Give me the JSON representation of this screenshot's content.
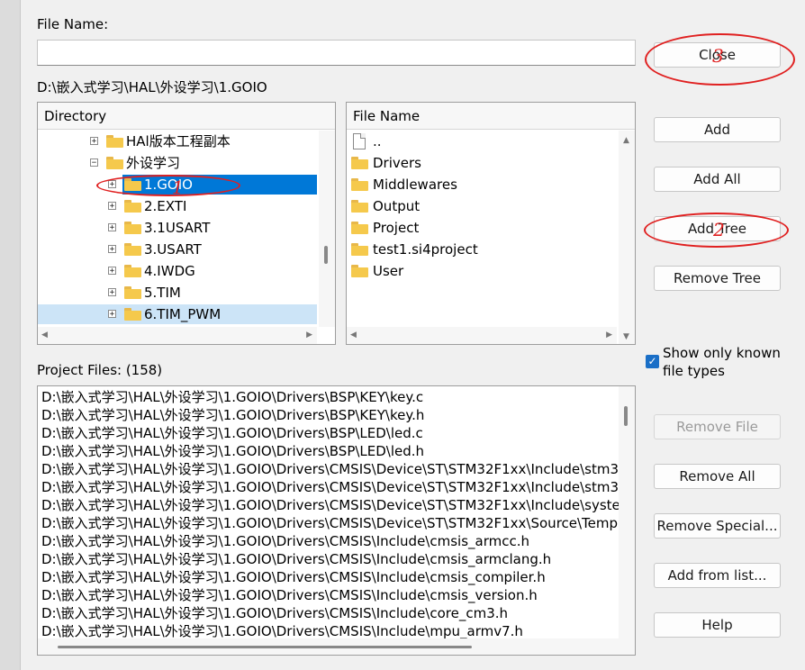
{
  "file_name": {
    "label": "File Name:",
    "value": ""
  },
  "current_path": "D:\\嵌入式学习\\HAL\\外设学习\\1.GOIO",
  "directory": {
    "header": "Directory",
    "items": [
      {
        "label": "HAl版本工程副本",
        "expander": "+",
        "selected": false,
        "hover": false
      },
      {
        "label": "外设学习",
        "expander": "−",
        "selected": false,
        "hover": false
      },
      {
        "label": "1.GOIO",
        "expander": "+",
        "selected": true,
        "hover": false
      },
      {
        "label": "2.EXTI",
        "expander": "+",
        "selected": false,
        "hover": false
      },
      {
        "label": "3.1USART",
        "expander": "+",
        "selected": false,
        "hover": false
      },
      {
        "label": "3.USART",
        "expander": "+",
        "selected": false,
        "hover": false
      },
      {
        "label": "4.IWDG",
        "expander": "+",
        "selected": false,
        "hover": false
      },
      {
        "label": "5.TIM",
        "expander": "+",
        "selected": false,
        "hover": false
      },
      {
        "label": "6.TIM_PWM",
        "expander": "+",
        "selected": false,
        "hover": true
      }
    ]
  },
  "file_list": {
    "header": "File Name",
    "items": [
      {
        "label": "..",
        "icon": "file-icon"
      },
      {
        "label": "Drivers",
        "icon": "folder-icon"
      },
      {
        "label": "Middlewares",
        "icon": "folder-icon"
      },
      {
        "label": "Output",
        "icon": "folder-icon"
      },
      {
        "label": "Project",
        "icon": "folder-icon"
      },
      {
        "label": "test1.si4project",
        "icon": "folder-icon"
      },
      {
        "label": "User",
        "icon": "folder-icon"
      }
    ]
  },
  "buttons": {
    "close": "Close",
    "add": "Add",
    "add_all": "Add All",
    "add_tree": "Add Tree",
    "remove_tree": "Remove Tree",
    "remove_file": "Remove File",
    "remove_all": "Remove All",
    "remove_special": "Remove Special...",
    "add_from_list": "Add from list...",
    "help": "Help"
  },
  "show_known": {
    "label_line1": "Show only known",
    "label_line2": "file types",
    "checked": true
  },
  "project_files": {
    "label": "Project Files: (158)",
    "items": [
      "D:\\嵌入式学习\\HAL\\外设学习\\1.GOIO\\Drivers\\BSP\\KEY\\key.c",
      "D:\\嵌入式学习\\HAL\\外设学习\\1.GOIO\\Drivers\\BSP\\KEY\\key.h",
      "D:\\嵌入式学习\\HAL\\外设学习\\1.GOIO\\Drivers\\BSP\\LED\\led.c",
      "D:\\嵌入式学习\\HAL\\外设学习\\1.GOIO\\Drivers\\BSP\\LED\\led.h",
      "D:\\嵌入式学习\\HAL\\外设学习\\1.GOIO\\Drivers\\CMSIS\\Device\\ST\\STM32F1xx\\Include\\stm3",
      "D:\\嵌入式学习\\HAL\\外设学习\\1.GOIO\\Drivers\\CMSIS\\Device\\ST\\STM32F1xx\\Include\\stm3",
      "D:\\嵌入式学习\\HAL\\外设学习\\1.GOIO\\Drivers\\CMSIS\\Device\\ST\\STM32F1xx\\Include\\syste",
      "D:\\嵌入式学习\\HAL\\外设学习\\1.GOIO\\Drivers\\CMSIS\\Device\\ST\\STM32F1xx\\Source\\Temp",
      "D:\\嵌入式学习\\HAL\\外设学习\\1.GOIO\\Drivers\\CMSIS\\Include\\cmsis_armcc.h",
      "D:\\嵌入式学习\\HAL\\外设学习\\1.GOIO\\Drivers\\CMSIS\\Include\\cmsis_armclang.h",
      "D:\\嵌入式学习\\HAL\\外设学习\\1.GOIO\\Drivers\\CMSIS\\Include\\cmsis_compiler.h",
      "D:\\嵌入式学习\\HAL\\外设学习\\1.GOIO\\Drivers\\CMSIS\\Include\\cmsis_version.h",
      "D:\\嵌入式学习\\HAL\\外设学习\\1.GOIO\\Drivers\\CMSIS\\Include\\core_cm3.h",
      "D:\\嵌入式学习\\HAL\\外设学习\\1.GOIO\\Drivers\\CMSIS\\Include\\mpu_armv7.h"
    ]
  },
  "annotations": [
    "1",
    "2",
    "3"
  ],
  "colors": {
    "selection": "#0078d7",
    "hover": "#cce4f7",
    "annotation": "#e02020",
    "checkbox": "#1a6fc7"
  }
}
